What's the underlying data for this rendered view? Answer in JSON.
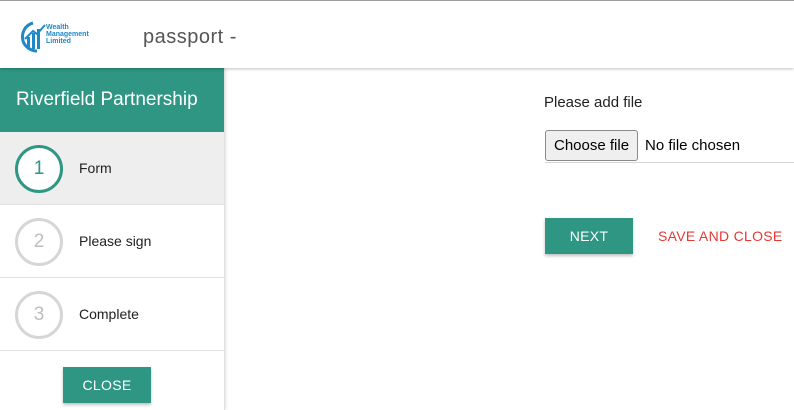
{
  "header": {
    "logo_lines": [
      "Wealth",
      "Management",
      "Limited"
    ],
    "title": "passport -"
  },
  "sidebar": {
    "title": "Riverfield Partnership",
    "steps": [
      {
        "number": "1",
        "label": "Form",
        "active": true
      },
      {
        "number": "2",
        "label": "Please sign",
        "active": false
      },
      {
        "number": "3",
        "label": "Complete",
        "active": false
      }
    ],
    "close_label": "CLOSE"
  },
  "main": {
    "file_prompt": "Please add file",
    "choose_file_label": "Choose file",
    "file_status": "No file chosen",
    "next_label": "NEXT",
    "save_close_label": "SAVE AND CLOSE"
  },
  "colors": {
    "accent": "#2e9683",
    "danger": "#e53935",
    "logo": "#1e88c8"
  }
}
